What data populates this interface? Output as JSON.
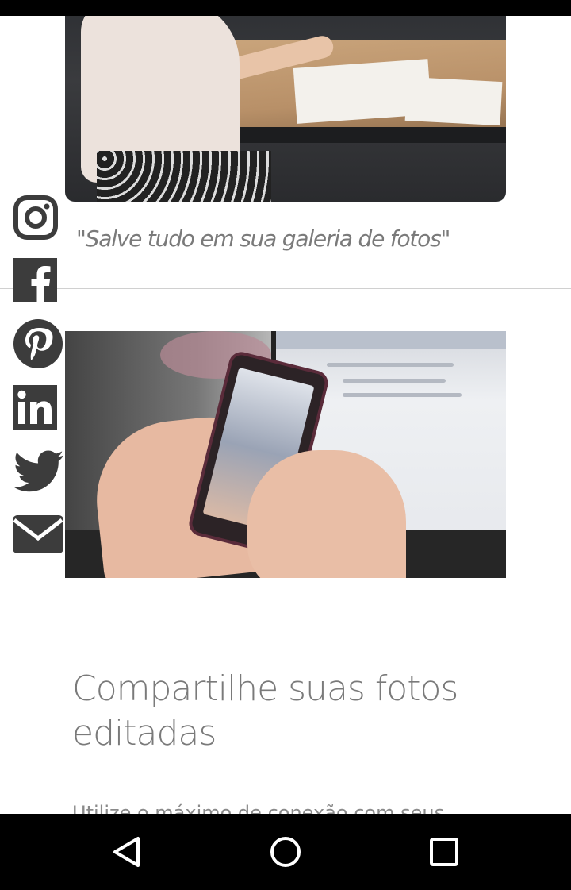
{
  "article": {
    "caption": "\"Salve tudo em sua galeria de fotos\"",
    "heading": "Compartilhe suas fotos editadas",
    "body_text": "Utilize o máximo de conexão com seus"
  },
  "images": {
    "top": "photo-people-drawing-at-table",
    "middle": "photo-hands-holding-smartphone-near-laptop"
  },
  "share_bar": {
    "icons": [
      "instagram-icon",
      "facebook-icon",
      "pinterest-icon",
      "linkedin-icon",
      "twitter-icon",
      "email-icon"
    ],
    "icon_color": "#3c3c3c"
  },
  "nav_bar": {
    "icons": [
      "back-triangle-icon",
      "home-circle-icon",
      "recents-square-icon"
    ]
  },
  "colors": {
    "text": "#7a7a7a",
    "divider": "#d0d0d0",
    "bars": "#000000",
    "background": "#ffffff"
  }
}
